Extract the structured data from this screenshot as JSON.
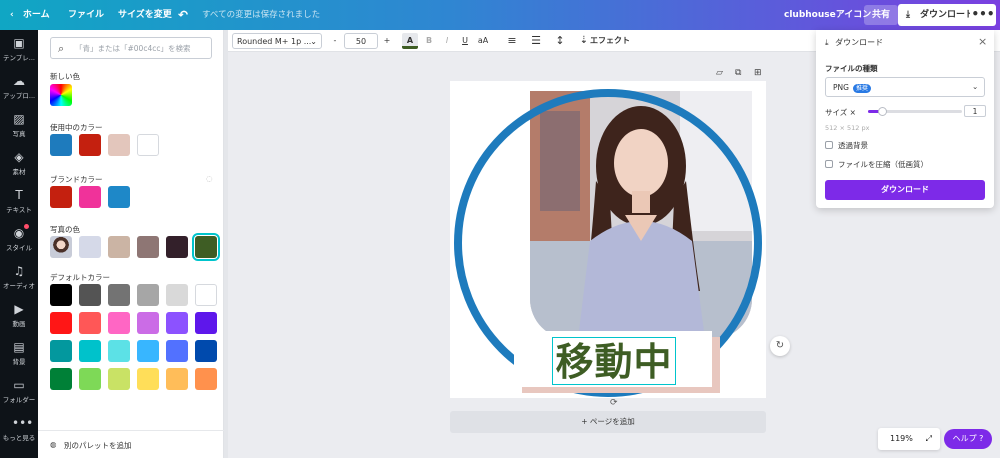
{
  "topbar": {
    "home": "ホーム",
    "file": "ファイル",
    "resize": "サイズを変更",
    "saved": "すべての変更は保存されました",
    "design_title": "clubhouseアイコン",
    "share": "共有",
    "download": "ダウンロード"
  },
  "rail": {
    "items": [
      {
        "label": "テンプレ..."
      },
      {
        "label": "アップロ..."
      },
      {
        "label": "写真"
      },
      {
        "label": "素材"
      },
      {
        "label": "テキスト"
      },
      {
        "label": "スタイル"
      },
      {
        "label": "オーディオ"
      },
      {
        "label": "動画"
      },
      {
        "label": "背景"
      },
      {
        "label": "フォルダー"
      },
      {
        "label": "もっと見る"
      }
    ]
  },
  "panel": {
    "search_placeholder": "「青」または「#00c4cc」を検索",
    "new_color": "新しい色",
    "in_use_title": "使用中のカラー",
    "in_use": [
      "#1e7bbd",
      "#c4200f",
      "#e3c6bc",
      "#ffffff"
    ],
    "brand_title": "ブランドカラー",
    "brand": [
      "#c4200f",
      "#f0329a",
      "#1e88c8"
    ],
    "photo_title": "写真の色",
    "photo": [
      "#d5d9e8",
      "#cbb4a4",
      "#8e7674",
      "#33202a",
      "#3e5d24"
    ],
    "default_title": "デフォルトカラー",
    "default": [
      [
        "#000000",
        "#545454",
        "#737373",
        "#a6a6a6",
        "#d9d9d9",
        "#ffffff"
      ],
      [
        "#ff1616",
        "#ff5757",
        "#ff66c4",
        "#cb6ce6",
        "#8c52ff",
        "#5e17eb"
      ],
      [
        "#03989e",
        "#00c2cb",
        "#5ce1e6",
        "#38b6ff",
        "#5271ff",
        "#004aad"
      ],
      [
        "#008037",
        "#7ed957",
        "#c9e265",
        "#ffde59",
        "#ffbd59",
        "#ff914d"
      ]
    ],
    "add_palette": "別のパレットを追加"
  },
  "toolbar": {
    "font": "Rounded M+ 1p ...",
    "minus": "-",
    "size": "50",
    "plus": "+",
    "color_a": "A",
    "bold": "B",
    "italic": "I",
    "underline": "U",
    "case": "aA",
    "effects": "エフェクト"
  },
  "canvas": {
    "label": "移動中",
    "add_page": "+ ページを追加"
  },
  "zoom": "119%",
  "help": "ヘルプ ?",
  "download_panel": {
    "title": "ダウンロード",
    "file_type_label": "ファイルの種類",
    "file_type": "PNG",
    "file_type_badge": "推奨",
    "size_label": "サイズ ×",
    "size_value": "1",
    "size_px": "512 × 512 px",
    "transparent": "透過背景",
    "compress": "ファイルを圧縮（低画質）",
    "download_button": "ダウンロード"
  },
  "colors": {
    "accent": "#7d2ae8",
    "selection": "#00c4cc",
    "ring_blue": "#1e7bbd",
    "label_green": "#3e5d24",
    "shadow_pink": "#e8c7bf"
  }
}
